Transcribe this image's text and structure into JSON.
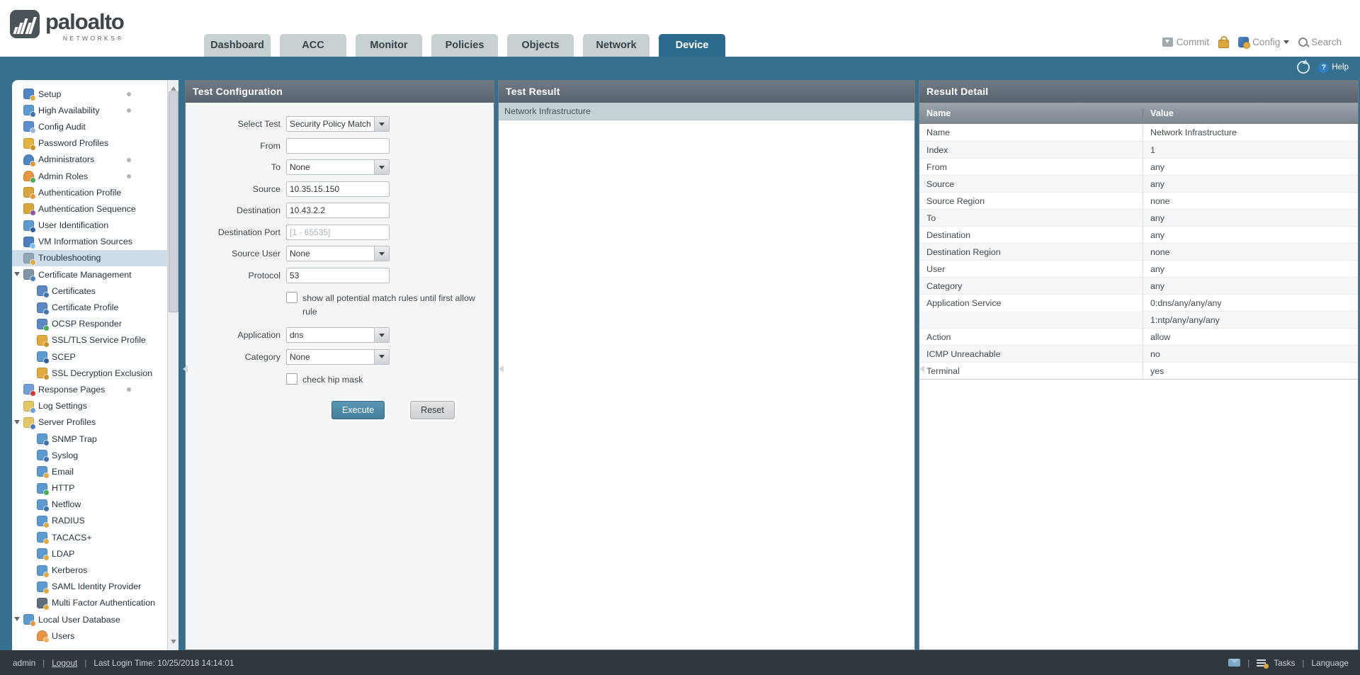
{
  "brand": {
    "word": "paloalto",
    "sub": "NETWORKS®"
  },
  "tabs": [
    {
      "label": "Dashboard",
      "active": false
    },
    {
      "label": "ACC",
      "active": false
    },
    {
      "label": "Monitor",
      "active": false
    },
    {
      "label": "Policies",
      "active": false
    },
    {
      "label": "Objects",
      "active": false
    },
    {
      "label": "Network",
      "active": false
    },
    {
      "label": "Device",
      "active": true
    }
  ],
  "header": {
    "commit": "Commit",
    "config": "Config",
    "search": "Search",
    "help": "Help"
  },
  "colors": {
    "accent_blue": "#35708E",
    "active_tab": "#2B6A8C",
    "execute_btn": "#44809C",
    "selected_row": "#C5D0D7",
    "sidebar_selected": "#CDDEEA"
  },
  "sidebar": {
    "items": [
      {
        "label": "Setup",
        "icon": "setup-icon",
        "c1": "#4E86C6",
        "c2": "#E2A93C",
        "dot": true
      },
      {
        "label": "High Availability",
        "icon": "high-availability-icon",
        "c1": "#5C9BD2",
        "c2": "#3F74AE",
        "dot": true
      },
      {
        "label": "Config Audit",
        "icon": "config-audit-icon",
        "c1": "#5C8FD0",
        "c2": "#9FB7CF"
      },
      {
        "label": "Password Profiles",
        "icon": "password-key-icon",
        "c1": "#E4B33F",
        "c2": "#C89325"
      },
      {
        "label": "Administrators",
        "icon": "administrator-person-icon",
        "c1": "#4E86C6",
        "c2": "#E8953F",
        "dot": true,
        "person": true
      },
      {
        "label": "Admin Roles",
        "icon": "admin-roles-check-icon",
        "c1": "#E8953F",
        "c2": "#4CAE4F",
        "dot": true,
        "person": true
      },
      {
        "label": "Authentication Profile",
        "icon": "authentication-profile-icon",
        "c1": "#D9A63C",
        "c2": "#E8953F"
      },
      {
        "label": "Authentication Sequence",
        "icon": "authentication-sequence-icon",
        "c1": "#D9A63C",
        "c2": "#8A55A2"
      },
      {
        "label": "User Identification",
        "icon": "user-id-card-icon",
        "c1": "#5C9BD2",
        "c2": "#2F5FA0"
      },
      {
        "label": "VM Information Sources",
        "icon": "vm-monitor-icon",
        "c1": "#4C7FC0",
        "c2": "#7EC3E8"
      },
      {
        "label": "Troubleshooting",
        "icon": "crossed-tools-icon",
        "c1": "#8FA6B5",
        "c2": "#E2A93C",
        "selected": true
      },
      {
        "label": "Certificate Management",
        "icon": "certificate-folder-icon",
        "c1": "#7E96A6",
        "c2": "#4C7FC0",
        "expand": true
      },
      {
        "label": "Certificates",
        "icon": "certificate-icon",
        "c1": "#5C87C5",
        "c2": "#3F74AE",
        "lvl": 1
      },
      {
        "label": "Certificate Profile",
        "icon": "certificate-profile-icon",
        "c1": "#5C87C5",
        "c2": "#3F74AE",
        "lvl": 1
      },
      {
        "label": "OCSP Responder",
        "icon": "ocsp-check-icon",
        "c1": "#5C87C5",
        "c2": "#4CAE4F",
        "lvl": 1
      },
      {
        "label": "SSL/TLS Service Profile",
        "icon": "padlock-icon",
        "c1": "#E2A93C",
        "c2": "#C89325",
        "lvl": 1
      },
      {
        "label": "SCEP",
        "icon": "scep-card-icon",
        "c1": "#5C9BD2",
        "c2": "#2F5FA0",
        "lvl": 1
      },
      {
        "label": "SSL Decryption Exclusion",
        "icon": "padlock-icon",
        "c1": "#E2A93C",
        "c2": "#C89325",
        "lvl": 1
      },
      {
        "label": "Response Pages",
        "icon": "response-pages-block-icon",
        "c1": "#6FA0D8",
        "c2": "#D33A2F",
        "dot": true
      },
      {
        "label": "Log Settings",
        "icon": "log-settings-folder-icon",
        "c1": "#E3C668",
        "c2": "#6FA0D8"
      },
      {
        "label": "Server Profiles",
        "icon": "server-folder-icon",
        "c1": "#E3C668",
        "c2": "#4C7FC0",
        "expand": true
      },
      {
        "label": "SNMP Trap",
        "icon": "server-page-icon",
        "c1": "#5C9BD2",
        "c2": "#3F74AE",
        "lvl": 1
      },
      {
        "label": "Syslog",
        "icon": "server-page-icon",
        "c1": "#5C9BD2",
        "c2": "#3F74AE",
        "lvl": 1
      },
      {
        "label": "Email",
        "icon": "email-envelope-icon",
        "c1": "#5C9BD2",
        "c2": "#E2A93C",
        "lvl": 1
      },
      {
        "label": "HTTP",
        "icon": "http-globe-icon",
        "c1": "#5C9BD2",
        "c2": "#4CAE4F",
        "lvl": 1
      },
      {
        "label": "Netflow",
        "icon": "server-page-icon",
        "c1": "#5C9BD2",
        "c2": "#3F74AE",
        "lvl": 1
      },
      {
        "label": "RADIUS",
        "icon": "server-lock-icon",
        "c1": "#5C9BD2",
        "c2": "#E2A93C",
        "lvl": 1
      },
      {
        "label": "TACACS+",
        "icon": "server-lock-icon",
        "c1": "#5C9BD2",
        "c2": "#E2A93C",
        "lvl": 1
      },
      {
        "label": "LDAP",
        "icon": "server-lock-icon",
        "c1": "#5C9BD2",
        "c2": "#E2A93C",
        "lvl": 1
      },
      {
        "label": "Kerberos",
        "icon": "server-lock-icon",
        "c1": "#5C9BD2",
        "c2": "#E2A93C",
        "lvl": 1
      },
      {
        "label": "SAML Identity Provider",
        "icon": "server-lock-icon",
        "c1": "#5C9BD2",
        "c2": "#E2A93C",
        "lvl": 1
      },
      {
        "label": "Multi Factor Authentication",
        "icon": "mfa-device-lock-icon",
        "c1": "#5E6E7A",
        "c2": "#E2A93C",
        "lvl": 1
      },
      {
        "label": "Local User Database",
        "icon": "user-database-card-icon",
        "c1": "#5C9BD2",
        "c2": "#E8953F",
        "expand": true
      },
      {
        "label": "Users",
        "icon": "user-person-icon",
        "c1": "#E8953F",
        "c2": "#F0B25C",
        "lvl": 1,
        "person": true
      }
    ]
  },
  "test_config": {
    "title": "Test Configuration",
    "fields": [
      {
        "label": "Select Test",
        "value": "Security Policy Match",
        "kind": "select"
      },
      {
        "label": "From",
        "value": "",
        "kind": "text"
      },
      {
        "label": "To",
        "value": "None",
        "kind": "select"
      },
      {
        "label": "Source",
        "value": "10.35.15.150",
        "kind": "text"
      },
      {
        "label": "Destination",
        "value": "10.43.2.2",
        "kind": "text"
      },
      {
        "label": "Destination Port",
        "value": "",
        "placeholder": "[1 - 65535]",
        "kind": "text"
      },
      {
        "label": "Source User",
        "value": "None",
        "kind": "select"
      },
      {
        "label": "Protocol",
        "value": "53",
        "kind": "text"
      },
      {
        "label": "show all potential match rules until first allow rule",
        "kind": "checkbox",
        "checked": false
      },
      {
        "label": "Application",
        "value": "dns",
        "kind": "select"
      },
      {
        "label": "Category",
        "value": "None",
        "kind": "select"
      },
      {
        "label": "check hip mask",
        "kind": "checkbox",
        "checked": false
      }
    ],
    "execute_label": "Execute",
    "reset_label": "Reset"
  },
  "test_result": {
    "title": "Test Result",
    "rows": [
      "Network Infrastructure"
    ]
  },
  "result_detail": {
    "title": "Result Detail",
    "columns": [
      "Name",
      "Value"
    ],
    "rows": [
      {
        "name": "Name",
        "value": "Network Infrastructure"
      },
      {
        "name": "Index",
        "value": "1"
      },
      {
        "name": "From",
        "value": "any"
      },
      {
        "name": "Source",
        "value": "any"
      },
      {
        "name": "Source Region",
        "value": "none"
      },
      {
        "name": "To",
        "value": "any"
      },
      {
        "name": "Destination",
        "value": "any"
      },
      {
        "name": "Destination Region",
        "value": "none"
      },
      {
        "name": "User",
        "value": "any"
      },
      {
        "name": "Category",
        "value": "any"
      },
      {
        "name": "Application Service",
        "value": "0:dns/any/any/any"
      },
      {
        "name": "",
        "value": "1:ntp/any/any/any",
        "cont": true
      },
      {
        "name": "Action",
        "value": "allow"
      },
      {
        "name": "ICMP Unreachable",
        "value": "no"
      },
      {
        "name": "Terminal",
        "value": "yes"
      }
    ]
  },
  "footer": {
    "user": "admin",
    "logout": "Logout",
    "last_login": "Last Login Time: 10/25/2018 14:14:01",
    "tasks": "Tasks",
    "language": "Language"
  }
}
